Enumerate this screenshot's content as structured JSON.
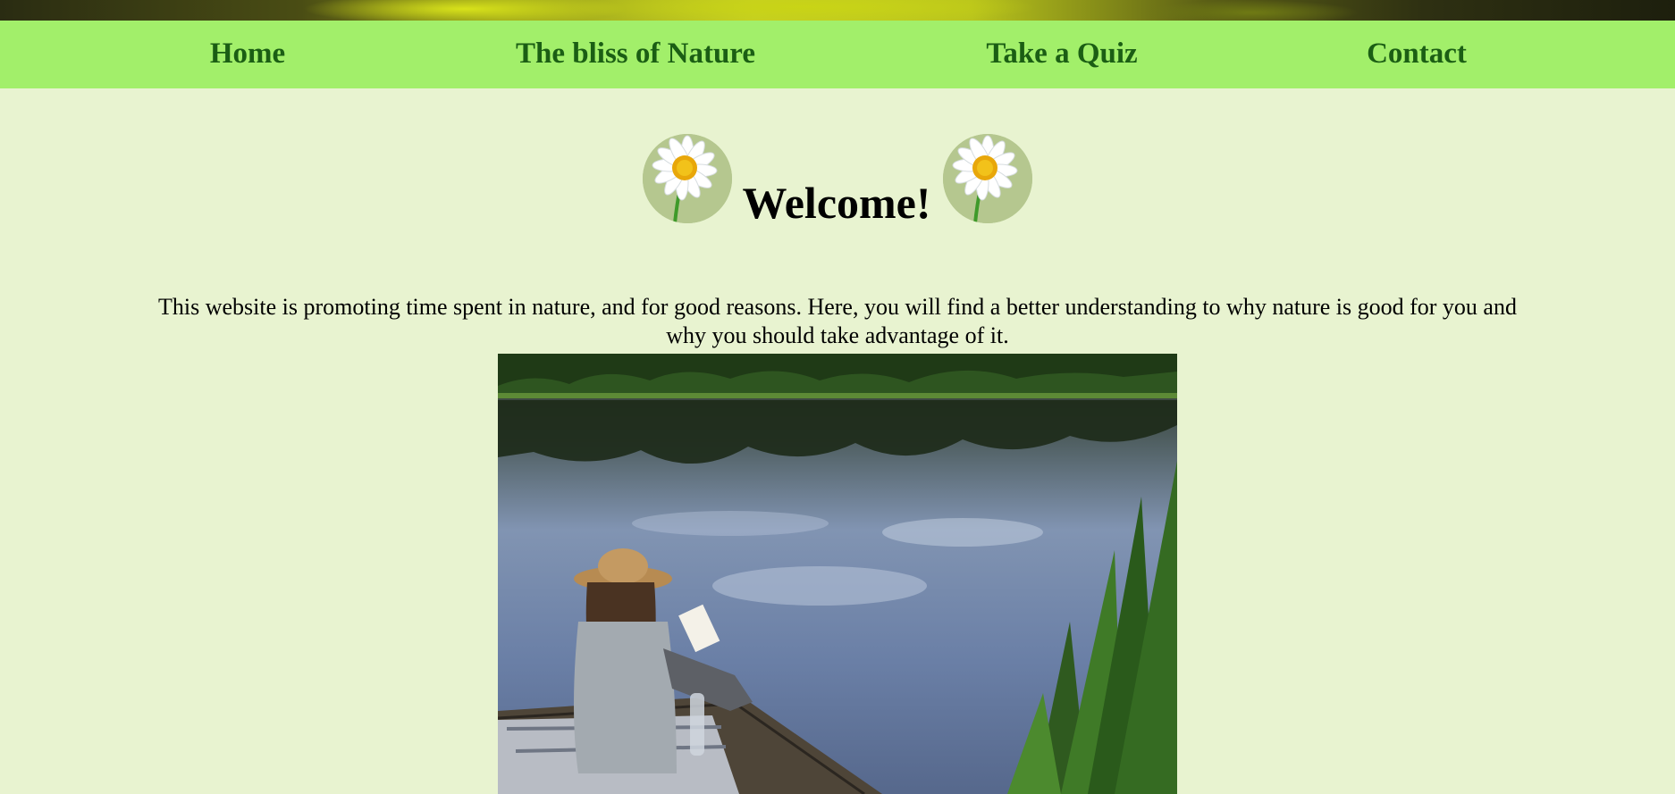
{
  "nav": {
    "items": [
      {
        "label": "Home"
      },
      {
        "label": "The bliss of Nature"
      },
      {
        "label": "Take a Quiz"
      },
      {
        "label": "Contact"
      }
    ]
  },
  "header": {
    "title": "Welcome!",
    "left_icon": "daisy-icon",
    "right_icon": "daisy-icon"
  },
  "main": {
    "intro_text": "This website is promoting time spent in nature, and for good reasons. Here, you will find a better understanding to why nature is good for you and why you should take advantage of it.",
    "hero_image": "woman-reading-on-lake-dock"
  },
  "colors": {
    "page_background": "#e8f3d0",
    "nav_background": "#a2ef6a",
    "nav_text": "#1b5e14"
  }
}
